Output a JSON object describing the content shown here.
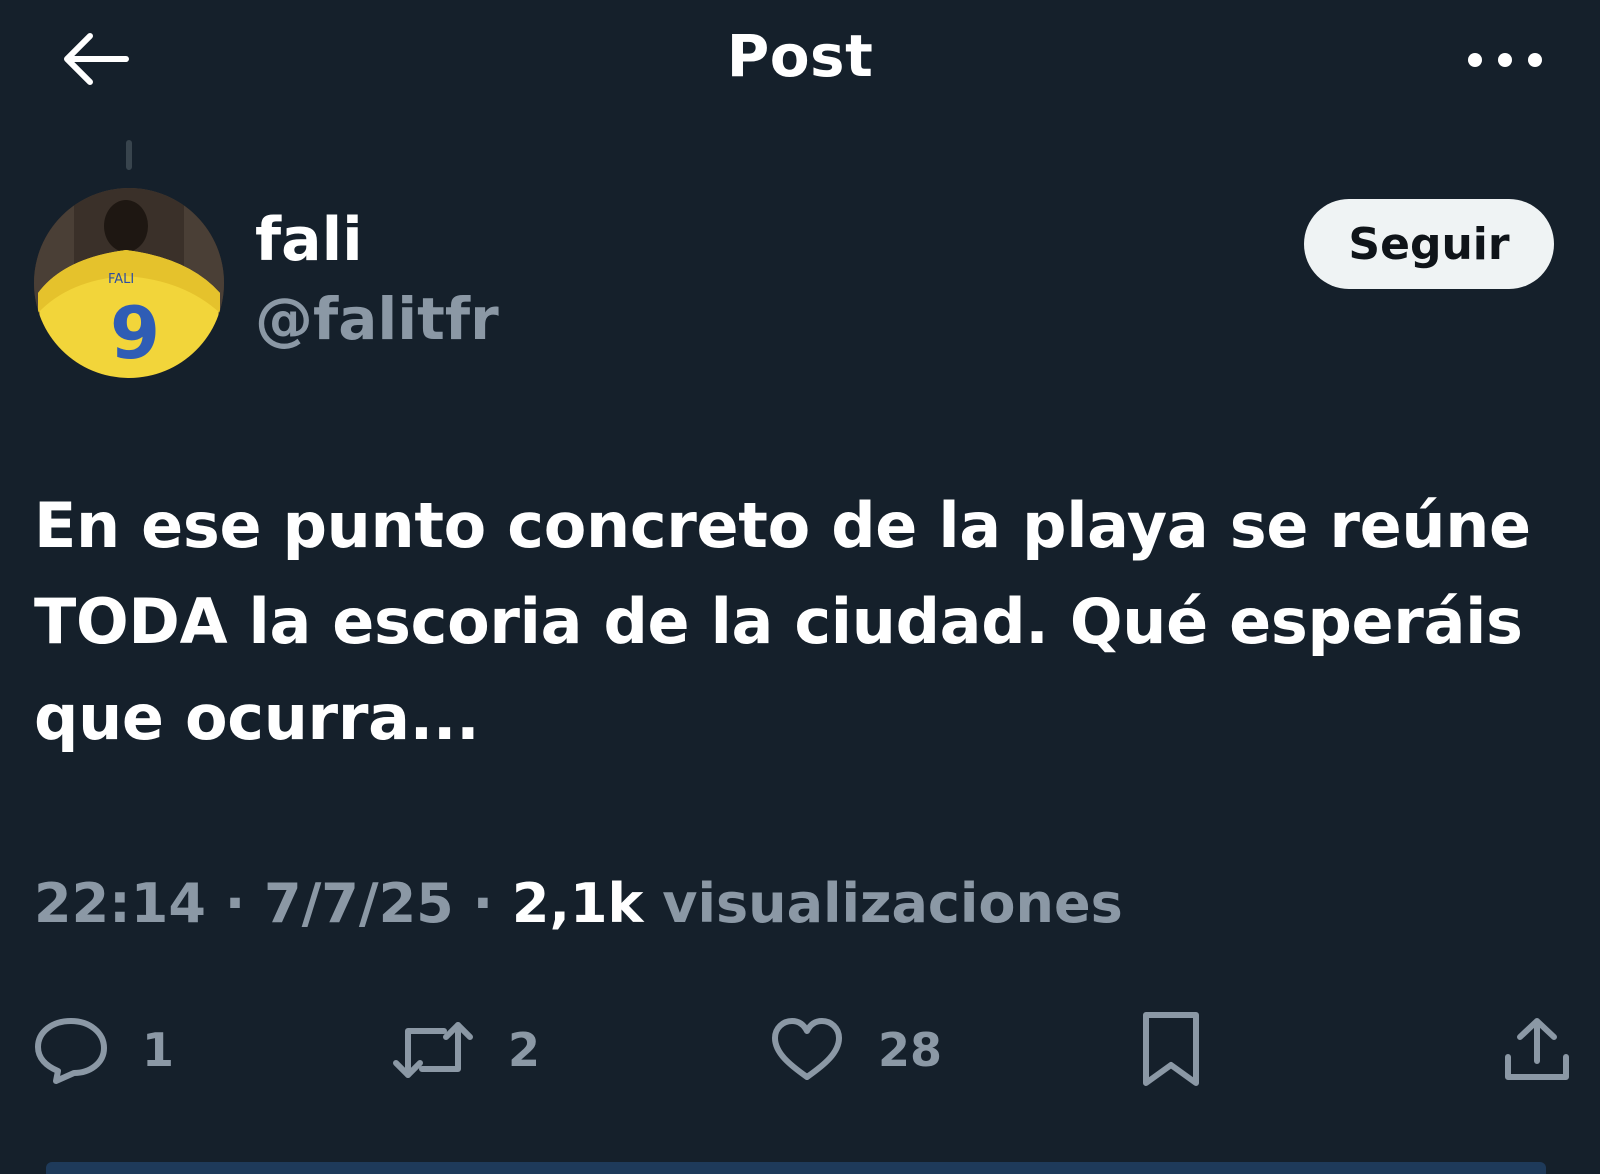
{
  "header": {
    "title": "Post",
    "back_icon": "arrow-left-icon",
    "more_icon": "more-horizontal-icon"
  },
  "author": {
    "display_name": "fali",
    "handle": "@falitfr",
    "avatar_icon": "avatar",
    "jersey_name": "FALI",
    "jersey_number": "9"
  },
  "follow_button": {
    "label": "Seguir"
  },
  "post": {
    "text": "En ese punto concreto de la playa se reúne\nTODA la escoria de la ciudad. Qué esperáis\nque ocurra..."
  },
  "meta": {
    "time": "22:14",
    "separator": " · ",
    "date": "7/7/25",
    "views_count": "2,1k",
    "views_label": " visualizaciones"
  },
  "actions": {
    "reply": {
      "icon": "reply-icon",
      "count": "1"
    },
    "repost": {
      "icon": "repost-icon",
      "count": "2"
    },
    "like": {
      "icon": "heart-icon",
      "count": "28"
    },
    "bookmark": {
      "icon": "bookmark-icon"
    },
    "share": {
      "icon": "share-icon"
    }
  },
  "colors": {
    "background": "#15202b",
    "text_primary": "#ffffff",
    "text_secondary": "#8b98a5",
    "button_bg": "#eff3f4",
    "button_text": "#0f1419"
  }
}
